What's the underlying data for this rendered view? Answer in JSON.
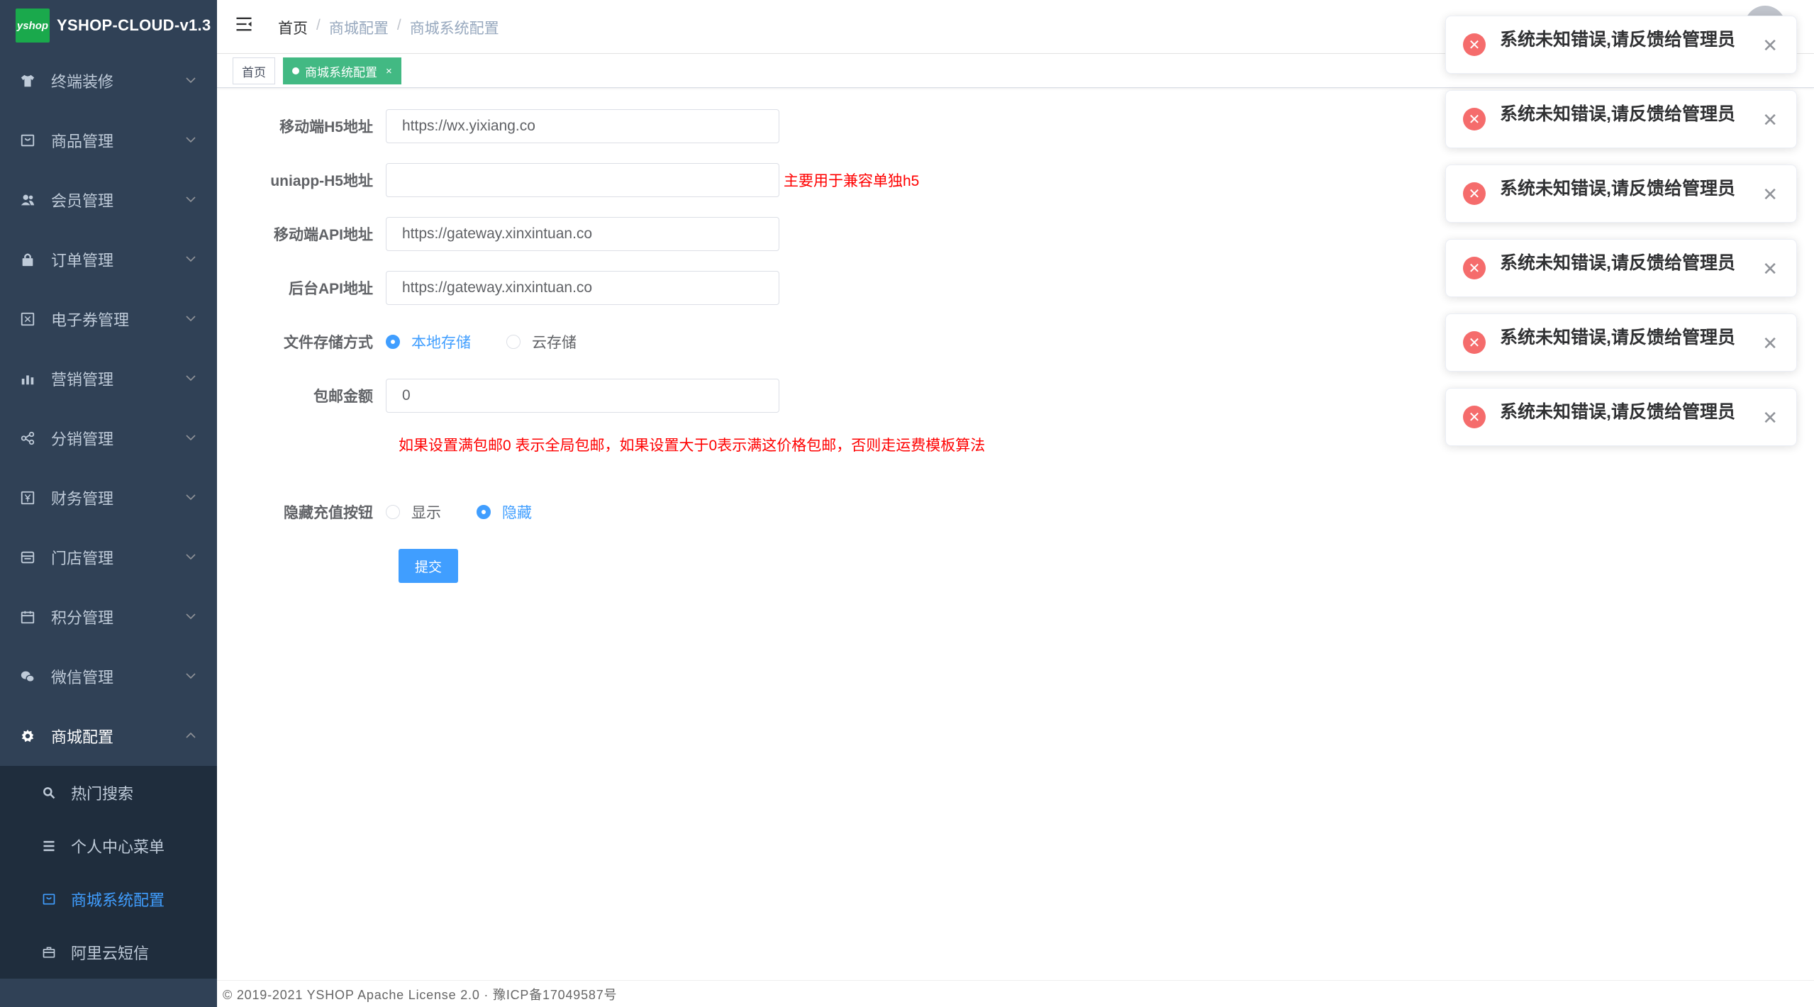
{
  "app": {
    "logo_text": "yshop",
    "title": "YSHOP-CLOUD-v1.3"
  },
  "sidebar": {
    "items": [
      {
        "label": "终端装修",
        "icon": "shirt-icon"
      },
      {
        "label": "商品管理",
        "icon": "box-icon"
      },
      {
        "label": "会员管理",
        "icon": "users-icon"
      },
      {
        "label": "订单管理",
        "icon": "lock-icon"
      },
      {
        "label": "电子券管理",
        "icon": "coupon-icon"
      },
      {
        "label": "营销管理",
        "icon": "chart-icon"
      },
      {
        "label": "分销管理",
        "icon": "share-icon"
      },
      {
        "label": "财务管理",
        "icon": "money-icon"
      },
      {
        "label": "门店管理",
        "icon": "store-icon"
      },
      {
        "label": "积分管理",
        "icon": "calendar-icon"
      },
      {
        "label": "微信管理",
        "icon": "wechat-icon"
      },
      {
        "label": "商城配置",
        "icon": "gear-icon"
      }
    ],
    "subitems": [
      {
        "label": "热门搜索",
        "icon": "search-icon"
      },
      {
        "label": "个人中心菜单",
        "icon": "list-icon"
      },
      {
        "label": "商城系统配置",
        "icon": "box-icon"
      },
      {
        "label": "阿里云短信",
        "icon": "briefcase-icon"
      }
    ]
  },
  "breadcrumb": [
    "首页",
    "商城配置",
    "商城系统配置"
  ],
  "breadcrumb_sep": "/",
  "tags": {
    "home": "首页",
    "current": "商城系统配置",
    "close": "×"
  },
  "form": {
    "h5_label": "移动端H5地址",
    "h5_value": "https://wx.yixiang.co",
    "uniapp_label": "uniapp-H5地址",
    "uniapp_value": "",
    "uniapp_hint": "主要用于兼容单独h5",
    "api_label": "移动端API地址",
    "api_value": "https://gateway.xinxintuan.co",
    "admin_api_label": "后台API地址",
    "admin_api_value": "https://gateway.xinxintuan.co",
    "storage_label": "文件存储方式",
    "storage_local": "本地存储",
    "storage_cloud": "云存储",
    "postage_label": "包邮金额",
    "postage_value": "0",
    "postage_hint": "如果设置满包邮0 表示全局包邮，如果设置大于0表示满这价格包邮，否则走运费模板算法",
    "recharge_label": "隐藏充值按钮",
    "recharge_show": "显示",
    "recharge_hide": "隐藏",
    "submit": "提交"
  },
  "footer": "© 2019-2021 YSHOP Apache License 2.0 · 豫ICP备17049587号",
  "notifications": [
    {
      "text": "系统未知错误,请反馈给管理员"
    },
    {
      "text": "系统未知错误,请反馈给管理员"
    },
    {
      "text": "系统未知错误,请反馈给管理员"
    },
    {
      "text": "系统未知错误,请反馈给管理员"
    },
    {
      "text": "系统未知错误,请反馈给管理员"
    },
    {
      "text": "系统未知错误,请反馈给管理员"
    }
  ],
  "colors": {
    "sidebar_bg": "#304156",
    "submenu_bg": "#1f2d3d",
    "primary": "#409eff",
    "tag_active": "#42b983",
    "error": "#f56c6c",
    "hint": "#ff0000"
  }
}
